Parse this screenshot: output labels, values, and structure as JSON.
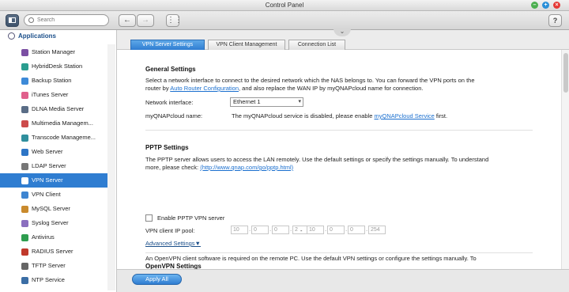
{
  "window": {
    "title": "Control Panel"
  },
  "toolbar": {
    "search_placeholder": "Search",
    "back": "←",
    "forward": "→",
    "grid": "⋮⋮",
    "help": "?"
  },
  "sidebar": {
    "header": "Applications",
    "items": [
      {
        "label": "Station Manager",
        "color": "#7b4fa3"
      },
      {
        "label": "HybridDesk Station",
        "color": "#2a9d8f"
      },
      {
        "label": "Backup Station",
        "color": "#3d8ad8"
      },
      {
        "label": "iTunes Server",
        "color": "#e0608c"
      },
      {
        "label": "DLNA Media Server",
        "color": "#5a6d86"
      },
      {
        "label": "Multimedia Managem...",
        "color": "#cc4b4b"
      },
      {
        "label": "Transcode Manageme...",
        "color": "#2f8f9d"
      },
      {
        "label": "Web Server",
        "color": "#2d75c6"
      },
      {
        "label": "LDAP Server",
        "color": "#777777"
      },
      {
        "label": "VPN Server",
        "color": "#ffffff"
      },
      {
        "label": "VPN Client",
        "color": "#3e85d1"
      },
      {
        "label": "MySQL Server",
        "color": "#c98a2d"
      },
      {
        "label": "Syslog Server",
        "color": "#8b6fbf"
      },
      {
        "label": "Antivirus",
        "color": "#2e9d4f"
      },
      {
        "label": "RADIUS Server",
        "color": "#c0392b"
      },
      {
        "label": "TFTP Server",
        "color": "#666666"
      },
      {
        "label": "NTP Service",
        "color": "#3b6ea5"
      }
    ]
  },
  "tabs": [
    "VPN Server Settings",
    "VPN Client Management",
    "Connection List"
  ],
  "general": {
    "title": "General Settings",
    "desc_1": "Select a network interface to connect to the desired network which the NAS belongs to. You can forward the VPN ports on the",
    "desc_2_pre": "router by ",
    "desc_2_link": "Auto Router Configuration",
    "desc_2_post": ", and also replace the WAN IP by myQNAPcloud name for connection.",
    "interface_label": "Network interface:",
    "interface_value": "Ethernet 1",
    "cloud_label": "myQNAPcloud name:",
    "cloud_pre": "The myQNAPcloud service is disabled, please enable ",
    "cloud_link": "myQNAPcloud Service",
    "cloud_post": " first."
  },
  "pptp": {
    "title": "PPTP Settings",
    "desc_1": "The PPTP server allows users to access the LAN remotely. Use the default settings or specify the settings manually. To understand",
    "desc_2_pre": "more, please check: ",
    "desc_2_link": "(http://www.qnap.com/go/pptp.html)",
    "enable_label": "Enable PPTP VPN server",
    "pool_label": "VPN client IP pool:",
    "ip_start": [
      "10",
      "0",
      "0",
      "2"
    ],
    "ip_end": [
      "10",
      "0",
      "0",
      "254"
    ],
    "dash": "-",
    "advanced": "Advanced Settings▼"
  },
  "openvpn": {
    "title": "OpenVPN Settings",
    "desc_1": "An OpenVPN client software is required on the remote PC. Use the default VPN settings or configure the settings manually. To"
  },
  "footer": {
    "apply": "Apply All"
  }
}
